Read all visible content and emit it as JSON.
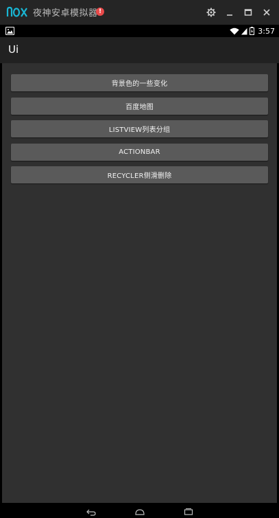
{
  "emulator": {
    "logo_text": "nox",
    "title": "夜神安卓模拟器",
    "alert_badge": "!",
    "controls": [
      "gear-icon",
      "minimize-icon",
      "maximize-icon",
      "close-icon"
    ]
  },
  "statusbar": {
    "notification_icon": "image-icon",
    "icons": [
      "wifi-icon",
      "signal-icon",
      "battery-icon"
    ],
    "time": "3:57"
  },
  "appbar": {
    "title": "Ui"
  },
  "buttons": [
    {
      "label": "背景色的一些变化"
    },
    {
      "label": "百度地图"
    },
    {
      "label": "LISTVIEW列表分组"
    },
    {
      "label": "ACTIONBAR"
    },
    {
      "label": "RECYCLER侧滑删除"
    }
  ],
  "navbar": {
    "icons": [
      "back-icon",
      "home-icon",
      "recents-icon"
    ]
  },
  "colors": {
    "titlebar_bg": "#252525",
    "appbar_bg": "#212121",
    "content_bg": "#303030",
    "button_bg": "#5a5a5a",
    "accent_logo": "#19b6d4",
    "alert": "#e84a4a"
  }
}
